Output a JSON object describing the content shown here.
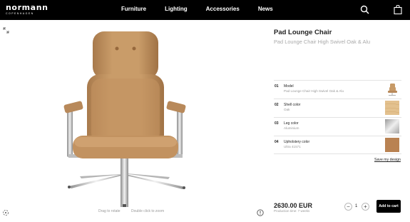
{
  "brand": {
    "name": "normann",
    "tagline": "COPENHAGEN"
  },
  "nav": {
    "links": [
      "Furniture",
      "Lighting",
      "Accessories",
      "News"
    ],
    "icons": [
      "search-icon",
      "bag-icon"
    ]
  },
  "viewer": {
    "hint_rotate": "Drag to rotate",
    "hint_zoom": "Double click to zoom",
    "icons": [
      "expand-icon",
      "rotate-icon",
      "info-icon"
    ]
  },
  "product": {
    "title": "Pad Lounge Chair",
    "subtitle": "Pad Lounge Chair High Swivel Oak & Alu",
    "options": [
      {
        "num": "01",
        "label": "Model",
        "value": "Pad Lounge Chair High Swivel Oak & Alu",
        "swatch": "chair-thumbnail"
      },
      {
        "num": "02",
        "label": "Shell color",
        "value": "Oak",
        "swatch": "oak-texture",
        "color": "#e3c18e"
      },
      {
        "num": "03",
        "label": "Leg color",
        "value": "Aluminium",
        "swatch": "aluminium-texture",
        "color": "#c9c9c9"
      },
      {
        "num": "04",
        "label": "Upholstery color",
        "value": "Ultra 41571",
        "swatch": "leather-swatch",
        "color": "#b98252"
      }
    ],
    "save_label": "Save my design",
    "price": "2630.00 EUR",
    "production_time": "Production time: 7 weeks",
    "quantity": "1",
    "qty_minus": "−",
    "qty_plus": "+",
    "cart_label": "Add to cart"
  },
  "colors": {
    "leather": "#c79a67",
    "nav_bg": "#000000",
    "aluminium": "#d8d8d8"
  }
}
